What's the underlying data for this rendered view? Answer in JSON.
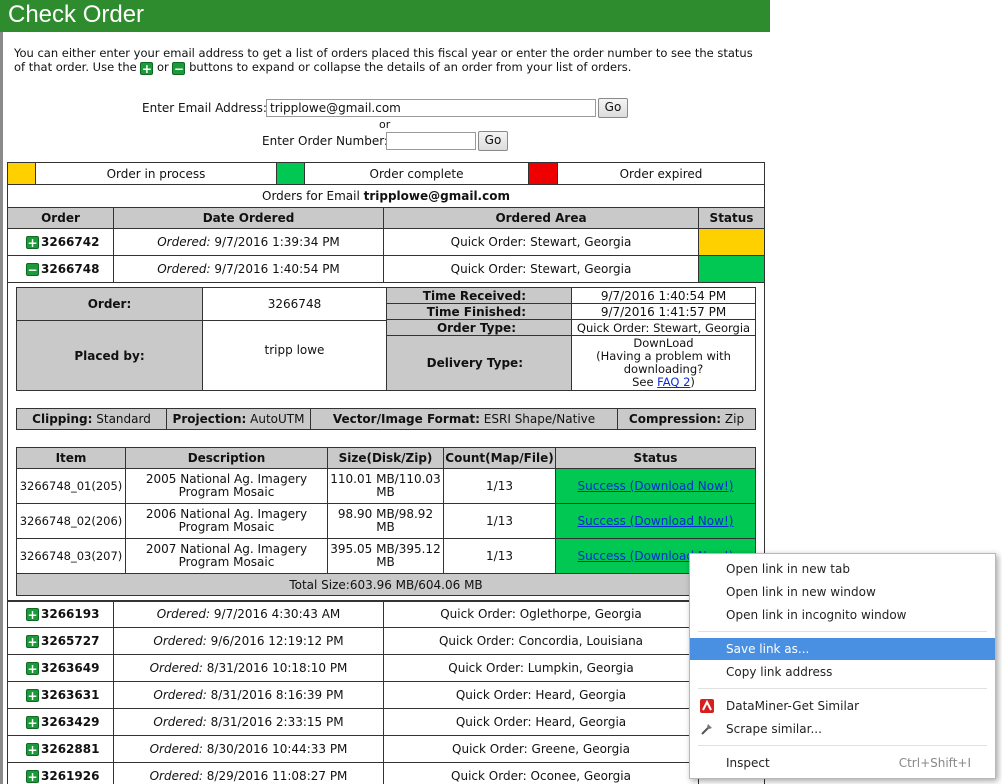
{
  "page": {
    "title": "Check Order"
  },
  "intro": {
    "part1": "You can either enter your email address to get a list of orders placed this fiscal year or enter the order number to see the status of that order. Use the",
    "or": "or",
    "part2": "buttons to expand or collapse the details of an order from your list of orders."
  },
  "email": {
    "label": "Enter Email Address:",
    "value": "tripplowe@gmail.com",
    "go": "Go"
  },
  "or_text": "or",
  "order_number": {
    "label": "Enter Order Number:",
    "value": "",
    "go": "Go"
  },
  "legend": {
    "in_process": "Order in process",
    "complete": "Order complete",
    "expired": "Order expired"
  },
  "orders_for": {
    "prefix": "Orders for Email",
    "email": "tripplowe@gmail.com"
  },
  "columns": {
    "order": "Order",
    "date": "Date Ordered",
    "area": "Ordered Area",
    "status": "Status"
  },
  "ordered_word": "Ordered:",
  "orders_top": [
    {
      "expander": "+",
      "number": "3266742",
      "date": "9/7/2016 1:39:34 PM",
      "area": "Quick Order: Stewart, Georgia",
      "status": "in_process"
    },
    {
      "expander": "−",
      "number": "3266748",
      "date": "9/7/2016 1:40:54 PM",
      "area": "Quick Order: Stewart, Georgia",
      "status": "complete"
    }
  ],
  "detail": {
    "order_label": "Order:",
    "order_value": "3266748",
    "placed_by_label": "Placed by:",
    "placed_by_value": "tripp lowe",
    "time_received_label": "Time Received:",
    "time_received": "9/7/2016 1:40:54 PM",
    "time_finished_label": "Time Finished:",
    "time_finished": "9/7/2016 1:41:57 PM",
    "order_type_label": "Order Type:",
    "order_type": "Quick Order: Stewart, Georgia",
    "delivery_type_label": "Delivery Type:",
    "delivery_line1": "DownLoad",
    "delivery_line2": "(Having a problem with",
    "delivery_line3": "downloading?",
    "delivery_see": "See",
    "delivery_faq": "FAQ 2",
    "delivery_close": ")"
  },
  "options": {
    "clipping_label": "Clipping:",
    "clipping": "Standard",
    "projection_label": "Projection:",
    "projection": "AutoUTM",
    "format_label": "Vector/Image Format:",
    "format": "ESRI Shape/Native",
    "compression_label": "Compression:",
    "compression": "Zip"
  },
  "items_columns": {
    "item": "Item",
    "description": "Description",
    "size": "Size(Disk/Zip)",
    "count": "Count(Map/File)",
    "status": "Status"
  },
  "items": [
    {
      "item": "3266748_01(205)",
      "desc1": "2005 National Ag. Imagery",
      "desc2": "Program Mosaic",
      "size1": "110.01 MB/110.03",
      "size2": "MB",
      "count": "1/13",
      "status": "Success (Download Now!)"
    },
    {
      "item": "3266748_02(206)",
      "desc1": "2006 National Ag. Imagery",
      "desc2": "Program Mosaic",
      "size1": "98.90 MB/98.92",
      "size2": "MB",
      "count": "1/13",
      "status": "Success (Download Now!)"
    },
    {
      "item": "3266748_03(207)",
      "desc1": "2007 National Ag. Imagery",
      "desc2": "Program Mosaic",
      "size1": "395.05 MB/395.12",
      "size2": "MB",
      "count": "1/13",
      "status": "Success (Download Now!)"
    }
  ],
  "total_size": "Total Size:603.96 MB/604.06 MB",
  "orders_bottom": [
    {
      "number": "3266193",
      "date": "9/7/2016 4:30:43 AM",
      "area": "Quick Order: Oglethorpe, Georgia"
    },
    {
      "number": "3265727",
      "date": "9/6/2016 12:19:12 PM",
      "area": "Quick Order: Concordia, Louisiana"
    },
    {
      "number": "3263649",
      "date": "8/31/2016 10:18:10 PM",
      "area": "Quick Order: Lumpkin, Georgia"
    },
    {
      "number": "3263631",
      "date": "8/31/2016 8:16:39 PM",
      "area": "Quick Order: Heard, Georgia"
    },
    {
      "number": "3263429",
      "date": "8/31/2016 2:33:15 PM",
      "area": "Quick Order: Heard, Georgia"
    },
    {
      "number": "3262881",
      "date": "8/30/2016 10:44:33 PM",
      "area": "Quick Order: Greene, Georgia"
    },
    {
      "number": "3261926",
      "date": "8/29/2016 11:08:27 PM",
      "area": "Quick Order: Oconee, Georgia"
    }
  ],
  "context_menu": {
    "items": [
      {
        "label": "Open link in new tab"
      },
      {
        "label": "Open link in new window"
      },
      {
        "label": "Open link in incognito window"
      },
      {
        "label": "Save link as..."
      },
      {
        "label": "Copy link address"
      },
      {
        "label": "DataMiner-Get Similar"
      },
      {
        "label": "Scrape similar..."
      },
      {
        "label": "Inspect",
        "shortcut": "Ctrl+Shift+I"
      }
    ]
  },
  "colors": {
    "header": "#2e8b2e",
    "in_process": "#ffd000",
    "complete": "#00c853",
    "expired": "#ee0000",
    "menu_highlight": "#4a90e2"
  }
}
